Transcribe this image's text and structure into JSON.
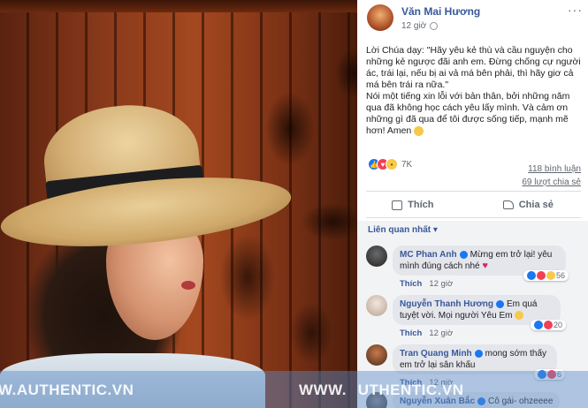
{
  "watermark": {
    "left_text": "W.AUTHENTIC.VN",
    "right_text": "WWW.AUTHENTIC.VN"
  },
  "post": {
    "author": "Văn Mai Hương",
    "time": "12 giờ",
    "more_label": "···",
    "caption_p1": "Lời Chúa dạy: \"Hãy yêu kẻ thù và cầu nguyện cho những kẻ ngược đãi anh em. Đừng chống cự người ác, trái lại, nếu bị ai vả má bên phải, thì hãy giơ cả má bên trái ra nữa.\"",
    "caption_p2": "Nói một tiếng xin lỗi với bản thân, bởi những năm qua đã không học cách yêu lấy mình. Và cảm ơn những gì đã qua để tôi được sống tiếp, mạnh mẽ hơn! Amen",
    "reaction_count": "7K",
    "comments_count": "118 bình luận",
    "shares_count": "69 lượt chia sẻ",
    "like_label": "Thích",
    "share_label": "Chia sẻ"
  },
  "comments_section": {
    "sort_label": "Liên quan nhất ▾",
    "like_label": "Thích",
    "items": [
      {
        "name": "MC Phan Anh",
        "text": "Mừng em trở lại! yêu mình đúng cách nhé",
        "time": "12 giờ",
        "reacts": "56"
      },
      {
        "name": "Nguyễn Thanh Hương",
        "text": "Em quá tuyệt vời. Mọi người Yêu Em",
        "time": "12 giờ",
        "reacts": "20"
      },
      {
        "name": "Tran Quang Minh",
        "text": "mong sớm thấy em trở lại sân khấu",
        "time": "12 giờ",
        "reacts": "6"
      },
      {
        "name": "Nguyễn Xuân Bắc",
        "text": "Cô gái- ohzeeee",
        "time": "",
        "reacts": ""
      }
    ]
  },
  "colors": {
    "link_blue": "#385898",
    "like_blue": "#1877f2",
    "love_red": "#f33e58"
  }
}
